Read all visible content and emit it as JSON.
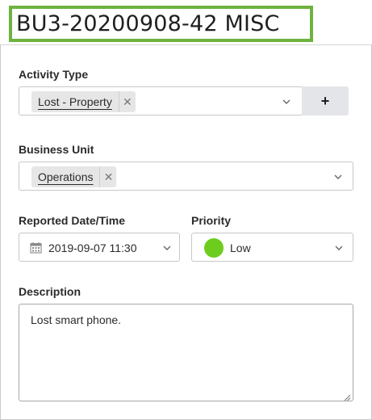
{
  "header": {
    "title": "BU3-20200908-42 MISC"
  },
  "form": {
    "activity_type": {
      "label": "Activity Type",
      "selected_chip": "Lost - Property",
      "add_button_label": "+"
    },
    "business_unit": {
      "label": "Business Unit",
      "selected_chip": "Operations"
    },
    "reported_datetime": {
      "label": "Reported Date/Time",
      "value": "2019-09-07 11:30"
    },
    "priority": {
      "label": "Priority",
      "value": "Low",
      "color": "#6ccd1e"
    },
    "description": {
      "label": "Description",
      "value": "Lost smart phone."
    }
  },
  "icons": {
    "remove_chip": "close-icon",
    "dropdown": "chevron-down-icon",
    "calendar": "calendar-icon",
    "resize": "resize-grip-icon"
  },
  "colors": {
    "title_highlight": "#6db33f",
    "add_button_bg": "#e3e5e8",
    "chip_bg": "#e6e6e6"
  }
}
